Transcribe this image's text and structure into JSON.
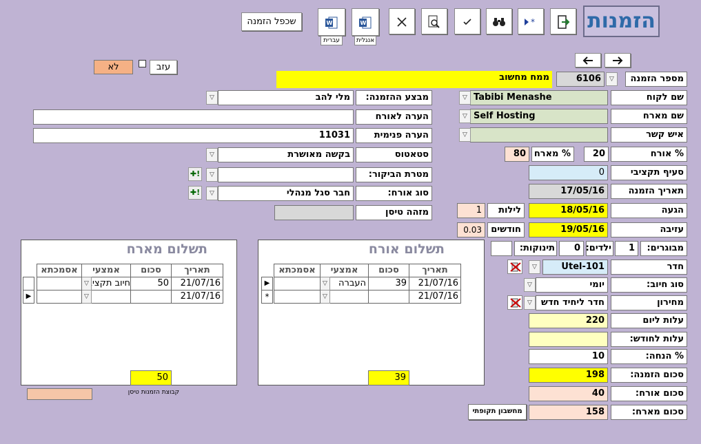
{
  "header": {
    "title": "הזמנות",
    "duplicate_button": "שכפל הזמנה",
    "word_hebrew_caption": "עברית",
    "word_english_caption": "אנגלית"
  },
  "order": {
    "order_no_label": "מספר הזמנה",
    "order_no": "6106",
    "booked_by": "ממח מחשוב",
    "customer_label": "שם לקוח",
    "customer": "Tabibi Menashe",
    "organizer_label": "שם מארח",
    "organizer": "Self Hosting",
    "contact_label": "איש קשר",
    "contact": "",
    "guest_pct_label": "% אורח",
    "guest_pct": "20",
    "host_pct_label": "% מארח",
    "host_pct": "80",
    "budget_label": "סעיף תקציבי",
    "budget": "0",
    "order_date_label": "תאריך הזמנה",
    "order_date": "17/05/16",
    "arrival_label": "הגעה",
    "arrival": "18/05/16",
    "nights_label": "לילות",
    "nights": "1",
    "departure_label": "עזיבה",
    "departure": "19/05/16",
    "months_label": "חודשים",
    "months": "0.03",
    "adults_label": "מבוגרים:",
    "adults": "1",
    "children_label": "ילדים:",
    "children": "0",
    "infants_label": "תינוקות:",
    "infants": "",
    "room_label": "חדר",
    "room": "Utel-101",
    "charge_type_label": "סוג חיוב:",
    "charge_type": "יומי",
    "price_list_label": "מחירון",
    "price_list": "חדר ליחיד חדש",
    "daily_cost_label": "עלות ליום",
    "daily_cost": "220",
    "monthly_cost_label": "עלות לחודש:",
    "monthly_cost": "",
    "discount_label": "% הנחה:",
    "discount": "10",
    "order_total_label": "סכום הזמנה:",
    "order_total": "198",
    "guest_total_label": "סכום אורח:",
    "guest_total": "40",
    "host_total_label": "סכום מארח:",
    "host_total": "158",
    "periodic_button": "מחשבון תקופתי",
    "leave_button": "עזב",
    "no_button": "לא",
    "executor_label": "מבצע  ההזמנה:",
    "executor": "מלי להב",
    "guest_note_label": "הערה לאורח",
    "guest_note": "",
    "internal_note_label": "הערה פנימית",
    "internal_note": "11031",
    "status_label": "סטאטוס",
    "status": "בקשה מאושרת",
    "visit_purpose_label": "מטרת הביקור:",
    "visit_purpose": "",
    "guest_type_label": "סוג אורח:",
    "guest_type": "חבר סגל מנהלי",
    "flight_id_label": "מזהה טיסן",
    "flight_id": "",
    "flight_group_label": "קבוצת הזמנות טיסן"
  },
  "guest_payment": {
    "title": "תשלום אורח",
    "columns": [
      "תאריך",
      "סכום",
      "אמצעי",
      "אסמכתא"
    ],
    "rows": [
      [
        "21/07/16",
        "39",
        "העברה",
        ""
      ],
      [
        "21/07/16",
        "",
        "",
        ""
      ]
    ],
    "total": "39"
  },
  "host_payment": {
    "title": "תשלום מארח",
    "columns": [
      "תאריך",
      "סכום",
      "אמצעי",
      "אסמכתא"
    ],
    "rows": [
      [
        "21/07/16",
        "50",
        "חיוב תקציב",
        ""
      ],
      [
        "21/07/16",
        "",
        "",
        ""
      ]
    ],
    "total": "50"
  },
  "colors": {
    "background": "#bfb3d3",
    "yellow": "#ffff00",
    "green": "#d8e4c8",
    "peach": "#fde1d3",
    "title": "#2e6aa8"
  },
  "icons": [
    "exit-icon",
    "new-record-icon",
    "binoculars-icon",
    "check-icon",
    "print-preview-icon",
    "delete-icon",
    "word-english-icon",
    "word-hebrew-icon",
    "arrow-left-icon",
    "arrow-right-icon"
  ]
}
